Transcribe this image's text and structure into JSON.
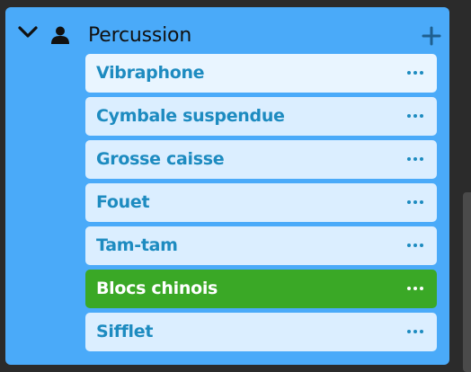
{
  "section": {
    "title": "Percussion",
    "icons": {
      "collapse": "chevron-down-icon",
      "person": "person-icon",
      "add": "plus-icon"
    }
  },
  "instruments": [
    {
      "label": "Vibraphone",
      "selected": false
    },
    {
      "label": "Cymbale suspendue",
      "selected": false
    },
    {
      "label": "Grosse caisse",
      "selected": false
    },
    {
      "label": "Fouet",
      "selected": false
    },
    {
      "label": "Tam-tam",
      "selected": false
    },
    {
      "label": "Blocs chinois",
      "selected": true
    },
    {
      "label": "Sifflet",
      "selected": false
    }
  ],
  "colors": {
    "panel": "#4aaaf9",
    "item_bg": "#dbeeff",
    "item_text": "#1d8bc0",
    "selected_bg": "#3aa826",
    "selected_text": "#ffffff"
  }
}
